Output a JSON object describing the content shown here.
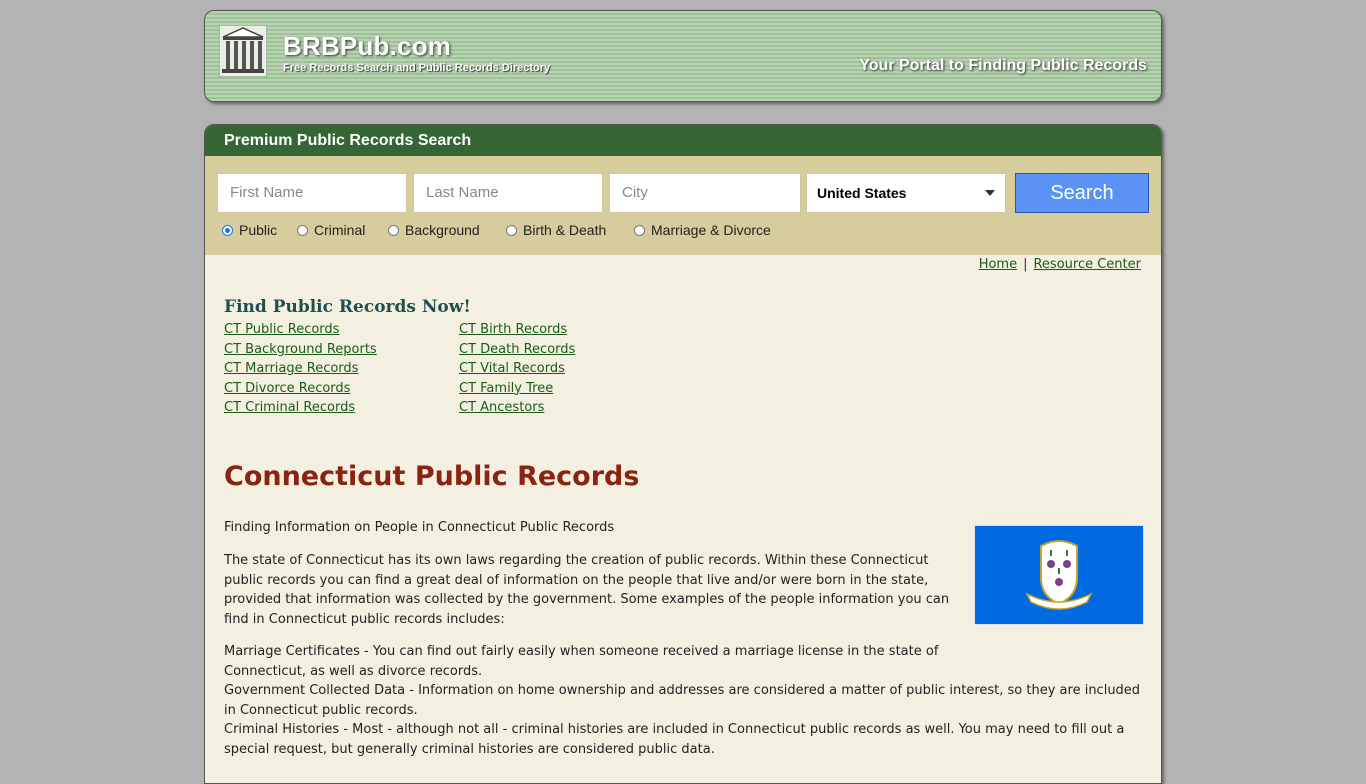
{
  "header": {
    "site_name": "BRBPub.com",
    "tagline": "Free Records Search and Public Records Directory",
    "portal_text": "Your Portal to Finding Public Records"
  },
  "search": {
    "heading": "Premium Public Records Search",
    "first_name_placeholder": "First Name",
    "last_name_placeholder": "Last Name",
    "city_placeholder": "City",
    "country_selected": "United States",
    "button_label": "Search",
    "record_types": [
      {
        "label": "Public",
        "selected": true
      },
      {
        "label": "Criminal",
        "selected": false
      },
      {
        "label": "Background",
        "selected": false
      },
      {
        "label": "Birth & Death",
        "selected": false
      },
      {
        "label": "Marriage & Divorce",
        "selected": false
      }
    ]
  },
  "nav": {
    "home": "Home",
    "resource_center": "Resource Center"
  },
  "find": {
    "title": "Find Public Records Now!",
    "left_links": [
      "CT Public Records",
      "CT Background Reports",
      "CT Marriage Records",
      "CT Divorce Records",
      "CT Criminal Records"
    ],
    "right_links": [
      "CT Birth Records",
      "CT Death Records",
      "CT Vital Records",
      "CT Family Tree",
      "CT Ancestors"
    ]
  },
  "article": {
    "title": "Connecticut Public Records",
    "intro": "Finding Information on People in Connecticut Public Records",
    "para1": "The state of Connecticut has its own laws regarding the creation of public records. Within these Connecticut public records you can find a great deal of information on the people that live and/or were born in the state, provided that information was collected by the government. Some examples of the people information you can find in Connecticut public records includes:",
    "item1": "Marriage Certificates - You can find out fairly easily when someone received a marriage license in the state of Connecticut, as well as divorce records.",
    "item2": "Government Collected Data - Information on home ownership and addresses are considered a matter of public interest, so they are included in Connecticut public records.",
    "item3": "Criminal Histories - Most - although not all - criminal histories are included in Connecticut public records as well. You may need to fill out a special request, but generally criminal histories are considered public data."
  },
  "colors": {
    "search_header": "#336633",
    "search_bar": "#d7cc9c",
    "panel_bg": "#f4f0e1",
    "title_red": "#8b2312",
    "link_green": "#1a5b1a",
    "button_blue": "#5b93f4",
    "flag_blue": "#006be0"
  }
}
